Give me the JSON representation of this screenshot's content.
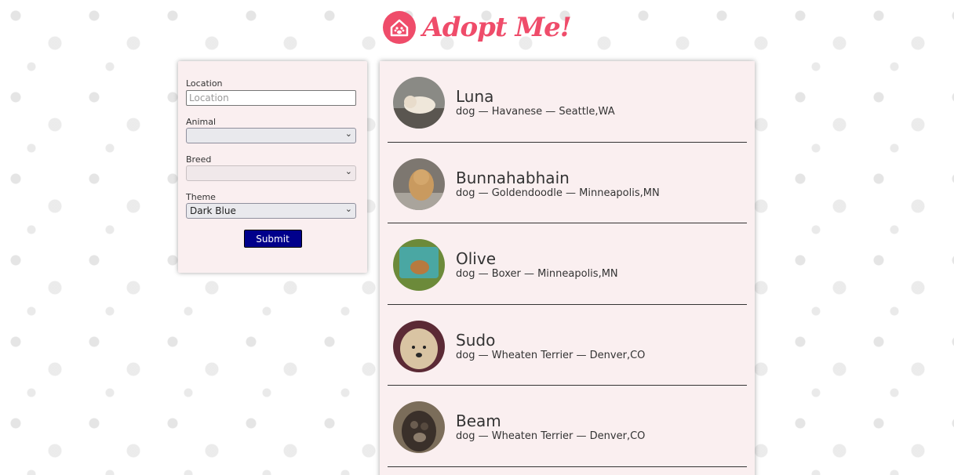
{
  "header": {
    "logo_text": "Adopt Me!",
    "logo_icon": "house-paw-icon"
  },
  "search": {
    "location_label": "Location",
    "location_placeholder": "Location",
    "location_value": "",
    "animal_label": "Animal",
    "animal_value": "",
    "breed_label": "Breed",
    "breed_value": "",
    "theme_label": "Theme",
    "theme_value": "Dark Blue",
    "submit_label": "Submit"
  },
  "pets": [
    {
      "name": "Luna",
      "desc": "dog — Havanese — Seattle,WA"
    },
    {
      "name": "Bunnahabhain",
      "desc": "dog — Goldendoodle — Minneapolis,MN"
    },
    {
      "name": "Olive",
      "desc": "dog — Boxer — Minneapolis,MN"
    },
    {
      "name": "Sudo",
      "desc": "dog — Wheaten Terrier — Denver,CO"
    },
    {
      "name": "Beam",
      "desc": "dog — Wheaten Terrier — Denver,CO"
    }
  ],
  "colors": {
    "brand": "#ef4c6a",
    "button": "#00008b",
    "panel": "#faeff0"
  }
}
